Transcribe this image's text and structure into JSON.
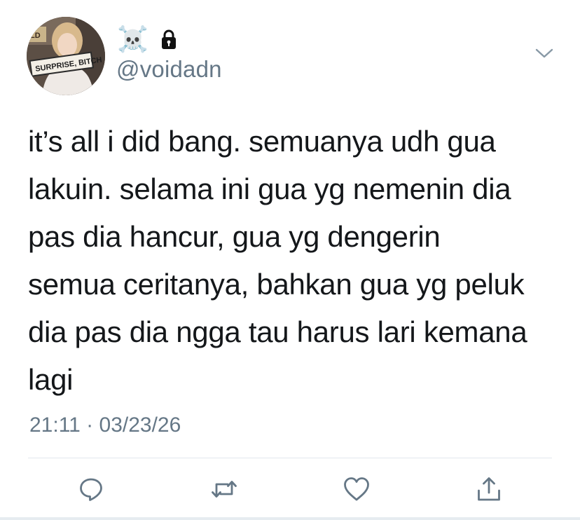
{
  "header": {
    "display_name_emoji": "☠️",
    "handle": "@voidadn",
    "protected_icon": "lock-icon",
    "menu_icon": "chevron-down-icon"
  },
  "avatar": {
    "sign_text": "SURPRISE, BITCH",
    "sign_text_top": "ILD"
  },
  "tweet": {
    "lines": [
      "it’s all i did bang. semuanya udh gua",
      "lakuin. selama ini gua yg nemenin dia",
      "pas dia hancur, gua yg dengerin",
      "semua ceritanya, bahkan gua yg peluk",
      "dia pas dia ngga tau harus lari kemana",
      "lagi"
    ],
    "timestamp": "21:11 · 03/23/26"
  },
  "actions": [
    {
      "name": "reply",
      "icon": "reply-icon"
    },
    {
      "name": "retweet",
      "icon": "retweet-icon"
    },
    {
      "name": "like",
      "icon": "heart-icon"
    },
    {
      "name": "share",
      "icon": "share-icon"
    }
  ],
  "colors": {
    "text": "#14171a",
    "secondary": "#657786",
    "divider": "#e1e8ed",
    "icon": "#657786"
  }
}
